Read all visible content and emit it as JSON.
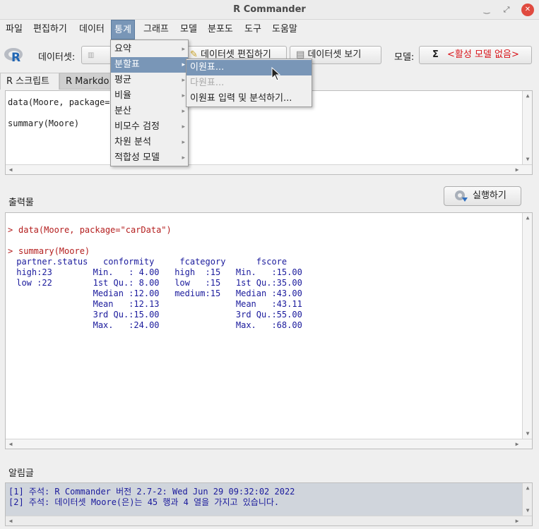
{
  "window": {
    "title": "R Commander"
  },
  "menubar": [
    "파일",
    "편집하기",
    "데이터",
    "통계",
    "그래프",
    "모델",
    "분포도",
    "도구",
    "도움말"
  ],
  "toolbar": {
    "dataset_label": "데이터셋:",
    "dataset_value": "",
    "edit_button": "데이터셋 편집하기",
    "view_button": "데이터셋 보기",
    "model_label": "모델:",
    "model_sigma": "Σ",
    "model_value": "<활성 모델 없음>"
  },
  "tabs": {
    "script": "R 스크립트",
    "markdown": "R Markdo"
  },
  "script": {
    "line1": "data(Moore, package=\"",
    "line2": "summary(Moore)"
  },
  "output_label": "출력물",
  "run_button": "실행하기",
  "output": {
    "cmd1": "data(Moore, package=\"carData\")",
    "cmd2": "summary(Moore)",
    "rows": [
      " partner.status   conformity     fcategory      fscore   ",
      " high:23        Min.   : 4.00   high  :15   Min.   :15.00  ",
      " low :22        1st Qu.: 8.00   low   :15   1st Qu.:35.00  ",
      "                Median :12.00   medium:15   Median :43.00  ",
      "                Mean   :12.13               Mean   :43.11  ",
      "                3rd Qu.:15.00               3rd Qu.:55.00  ",
      "                Max.   :24.00               Max.   :68.00  "
    ],
    "prompt": ">"
  },
  "messages_label": "알림글",
  "messages": [
    "[1] 주석: R Commander 버전 2.7-2: Wed Jun 29 09:32:02 2022",
    "[2] 주석: 데이터셋 Moore(은)는 45 행과 4 열을 가지고 있습니다."
  ],
  "stats_menu": [
    "요약",
    "분할표",
    "평균",
    "비율",
    "분산",
    "비모수 검정",
    "차원 분석",
    "적합성 모델"
  ],
  "contingency_submenu": [
    "이원표...",
    "다원표...",
    "이원표 입력 및 분석하기..."
  ]
}
